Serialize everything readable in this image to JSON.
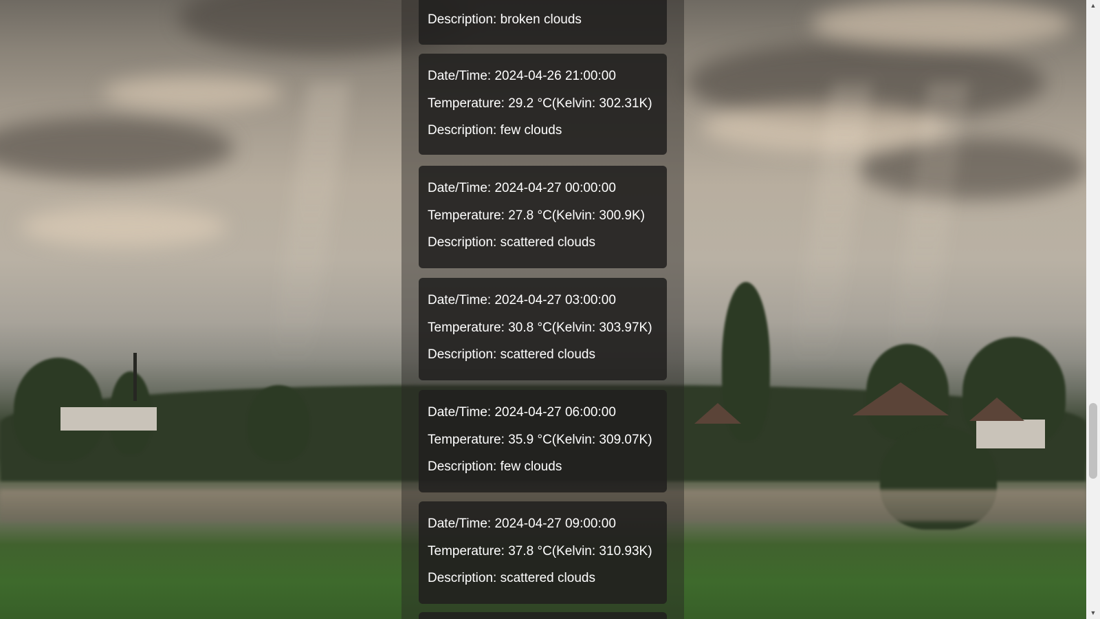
{
  "forecast": [
    {
      "description_label": "Description: broken clouds"
    },
    {
      "datetime_label": "Date/Time: 2024-04-26 21:00:00",
      "temperature_label": "Temperature: 29.2 °C(Kelvin: 302.31K)",
      "description_label": "Description: few clouds"
    },
    {
      "datetime_label": "Date/Time: 2024-04-27 00:00:00",
      "temperature_label": "Temperature: 27.8 °C(Kelvin: 300.9K)",
      "description_label": "Description: scattered clouds"
    },
    {
      "datetime_label": "Date/Time: 2024-04-27 03:00:00",
      "temperature_label": "Temperature: 30.8 °C(Kelvin: 303.97K)",
      "description_label": "Description: scattered clouds"
    },
    {
      "datetime_label": "Date/Time: 2024-04-27 06:00:00",
      "temperature_label": "Temperature: 35.9 °C(Kelvin: 309.07K)",
      "description_label": "Description: few clouds"
    },
    {
      "datetime_label": "Date/Time: 2024-04-27 09:00:00",
      "temperature_label": "Temperature: 37.8 °C(Kelvin: 310.93K)",
      "description_label": "Description: scattered clouds"
    }
  ],
  "scrollbar": {
    "up_icon": "triangle-up-icon",
    "down_icon": "triangle-down-icon"
  },
  "colors": {
    "card_background": "#211f1e",
    "card_text": "#ffffff",
    "scrollbar_track": "#f1f1f1",
    "scrollbar_thumb": "#c1c1c1"
  }
}
